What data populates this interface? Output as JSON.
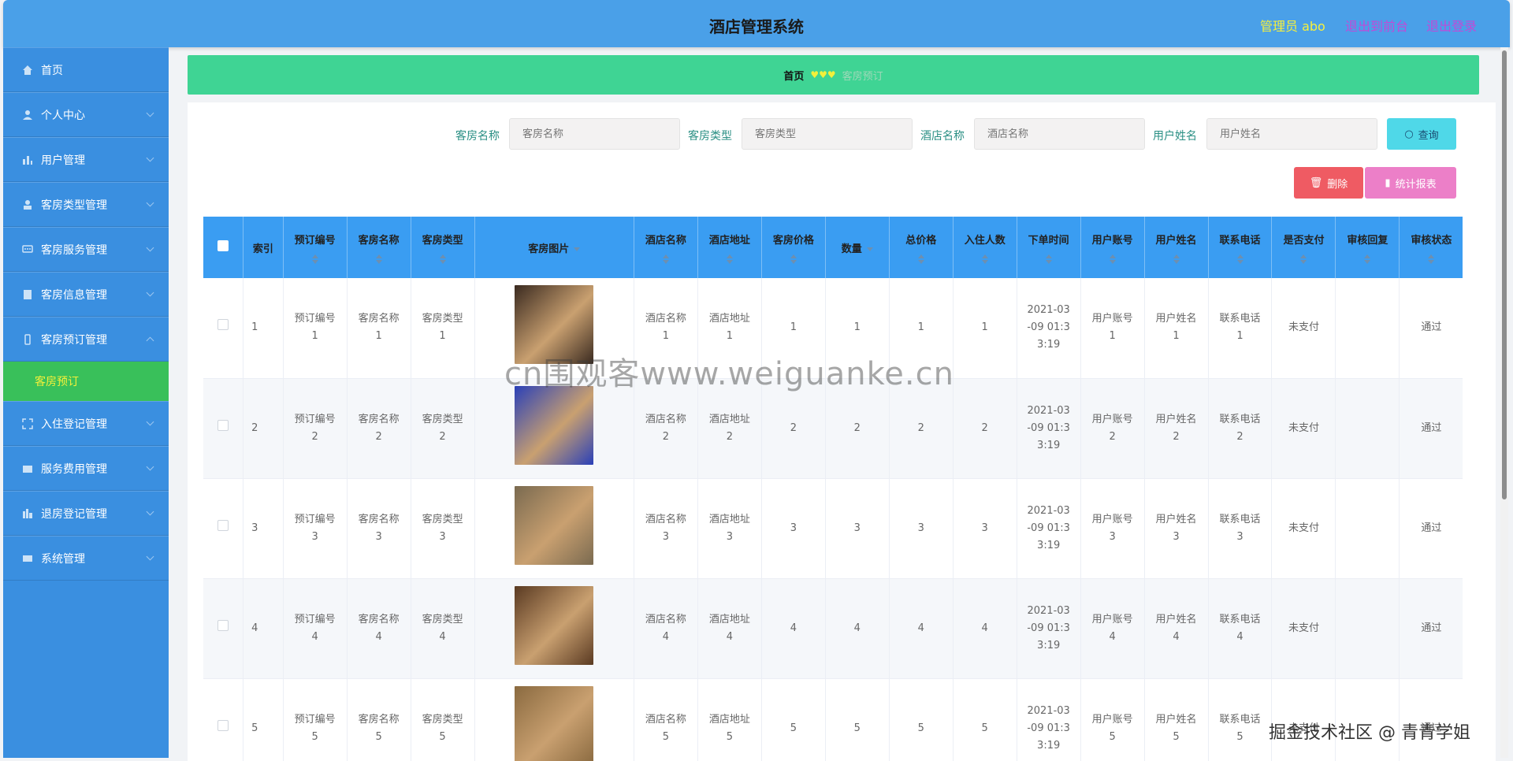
{
  "header": {
    "title": "酒店管理系统",
    "admin": "管理员 abo",
    "back_label": "退出到前台",
    "logout_label": "退出登录"
  },
  "sidebar": {
    "items": [
      {
        "label": "首页",
        "icon": "home-icon"
      },
      {
        "label": "个人中心",
        "icon": "user-icon"
      },
      {
        "label": "用户管理",
        "icon": "bar-chart-icon"
      },
      {
        "label": "客房类型管理",
        "icon": "person-icon"
      },
      {
        "label": "客房服务管理",
        "icon": "chat-icon"
      },
      {
        "label": "客房信息管理",
        "icon": "list-icon"
      },
      {
        "label": "客房预订管理",
        "icon": "phone-icon"
      },
      {
        "label": "入住登记管理",
        "icon": "expand-icon"
      },
      {
        "label": "服务费用管理",
        "icon": "card-icon"
      },
      {
        "label": "退房登记管理",
        "icon": "chart-icon"
      },
      {
        "label": "系统管理",
        "icon": "grid-icon"
      }
    ],
    "sub_item": "客房预订"
  },
  "breadcrumb": {
    "home": "首页",
    "separator": "♥♥♥",
    "current": "客房预订"
  },
  "search": {
    "fields": [
      {
        "label": "客房名称",
        "placeholder": "客房名称"
      },
      {
        "label": "客房类型",
        "placeholder": "客房类型"
      },
      {
        "label": "酒店名称",
        "placeholder": "酒店名称"
      },
      {
        "label": "用户姓名",
        "placeholder": "用户姓名"
      }
    ],
    "query_label": "查询"
  },
  "actions": {
    "delete_label": "删除",
    "stat_label": "统计报表"
  },
  "table": {
    "columns": [
      "索引",
      "预订编号",
      "客房名称",
      "客房类型",
      "客房图片",
      "酒店名称",
      "酒店地址",
      "客房价格",
      "数量",
      "总价格",
      "入住人数",
      "下单时间",
      "用户账号",
      "用户姓名",
      "联系电话",
      "是否支付",
      "审核回复",
      "审核状态"
    ],
    "rows": [
      {
        "index": "1",
        "order_no": "预订编号\n1",
        "room_name": "客房名称\n1",
        "room_type": "客房类型\n1",
        "hotel_name": "酒店名称\n1",
        "hotel_addr": "酒店地址\n1",
        "price": "1",
        "qty": "1",
        "total": "1",
        "guests": "1",
        "time": "2021-03\n-09 01:3\n3:19",
        "account": "用户账号\n1",
        "user_name": "用户姓名\n1",
        "phone": "联系电话\n1",
        "paid": "未支付",
        "reply": "",
        "status": "通过",
        "img_color": "#3a2a20"
      },
      {
        "index": "2",
        "order_no": "预订编号\n2",
        "room_name": "客房名称\n2",
        "room_type": "客房类型\n2",
        "hotel_name": "酒店名称\n2",
        "hotel_addr": "酒店地址\n2",
        "price": "2",
        "qty": "2",
        "total": "2",
        "guests": "2",
        "time": "2021-03\n-09 01:3\n3:19",
        "account": "用户账号\n2",
        "user_name": "用户姓名\n2",
        "phone": "联系电话\n2",
        "paid": "未支付",
        "reply": "",
        "status": "通过",
        "img_color": "#2a40b8"
      },
      {
        "index": "3",
        "order_no": "预订编号\n3",
        "room_name": "客房名称\n3",
        "room_type": "客房类型\n3",
        "hotel_name": "酒店名称\n3",
        "hotel_addr": "酒店地址\n3",
        "price": "3",
        "qty": "3",
        "total": "3",
        "guests": "3",
        "time": "2021-03\n-09 01:3\n3:19",
        "account": "用户账号\n3",
        "user_name": "用户姓名\n3",
        "phone": "联系电话\n3",
        "paid": "未支付",
        "reply": "",
        "status": "通过",
        "img_color": "#7a6a50"
      },
      {
        "index": "4",
        "order_no": "预订编号\n4",
        "room_name": "客房名称\n4",
        "room_type": "客房类型\n4",
        "hotel_name": "酒店名称\n4",
        "hotel_addr": "酒店地址\n4",
        "price": "4",
        "qty": "4",
        "total": "4",
        "guests": "4",
        "time": "2021-03\n-09 01:3\n3:19",
        "account": "用户账号\n4",
        "user_name": "用户姓名\n4",
        "phone": "联系电话\n4",
        "paid": "未支付",
        "reply": "",
        "status": "通过",
        "img_color": "#5a3a22"
      },
      {
        "index": "5",
        "order_no": "预订编号\n5",
        "room_name": "客房名称\n5",
        "room_type": "客房类型\n5",
        "hotel_name": "酒店名称\n5",
        "hotel_addr": "酒店地址\n5",
        "price": "5",
        "qty": "5",
        "total": "5",
        "guests": "5",
        "time": "2021-03\n-09 01:3\n3:19",
        "account": "用户账号\n5",
        "user_name": "用户姓名\n5",
        "phone": "联系电话\n5",
        "paid": "未支付",
        "reply": "",
        "status": "通过",
        "img_color": "#8a6a40"
      }
    ]
  },
  "watermark": "cn围观客www.weiguanke.cn",
  "watermark2": "掘金技术社区 @ 青青学姐"
}
